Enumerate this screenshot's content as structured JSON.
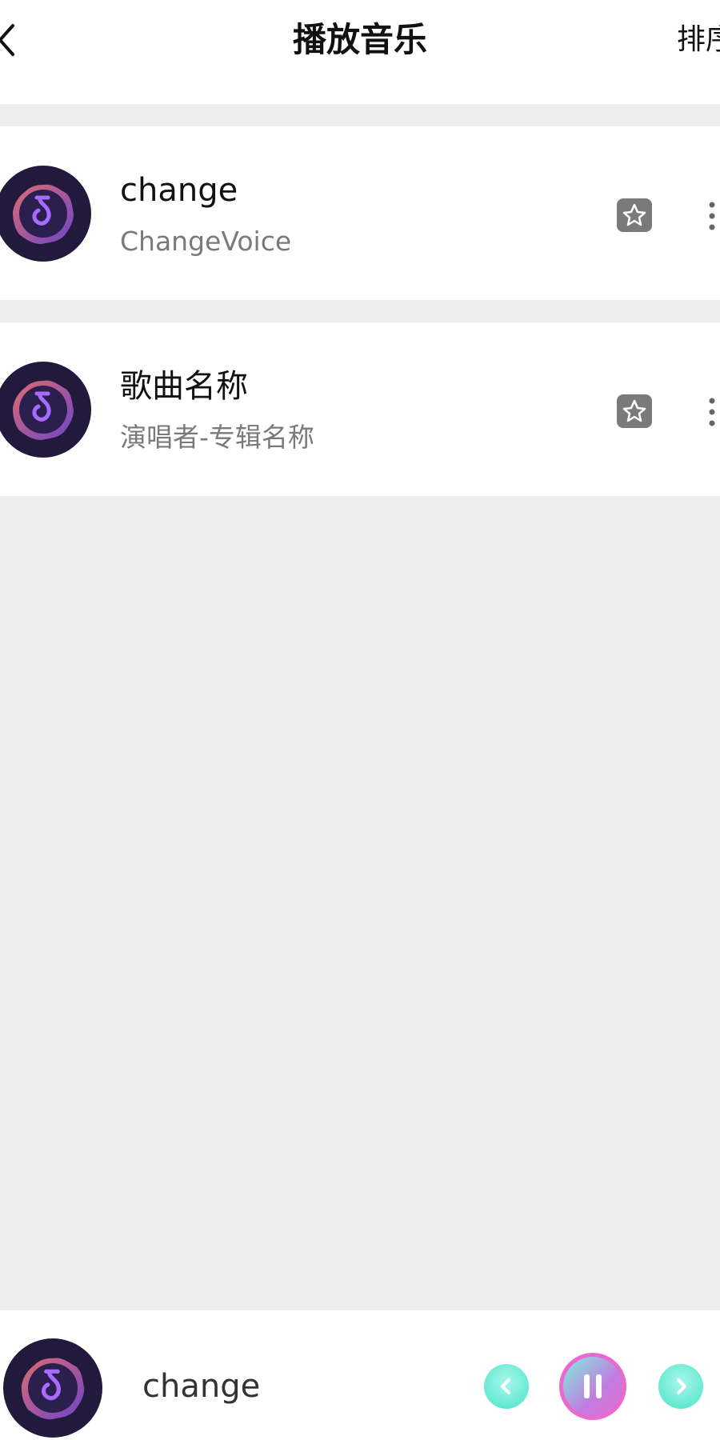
{
  "header": {
    "title": "播放音乐",
    "action_label": "排序"
  },
  "songs": [
    {
      "title": "change",
      "subtitle": "ChangeVoice"
    },
    {
      "title": "歌曲名称",
      "subtitle": "演唱者-专辑名称"
    }
  ],
  "player": {
    "now_playing": "change",
    "state": "playing"
  },
  "icons": {
    "back": "back-arrow-icon",
    "cover": "music-note-icon",
    "favorite": "star-icon",
    "more": "vertical-ellipsis-icon",
    "prev": "chevron-left-icon",
    "pause": "pause-icon",
    "next": "chevron-right-icon"
  },
  "colors": {
    "background": "#eeedee",
    "accent_cyan": "#7ff0dc",
    "accent_pink": "#e86ad0",
    "cover_dark": "#221a3d",
    "cover_purple": "#8a48e8",
    "icon_gray": "#7a7a7a"
  }
}
